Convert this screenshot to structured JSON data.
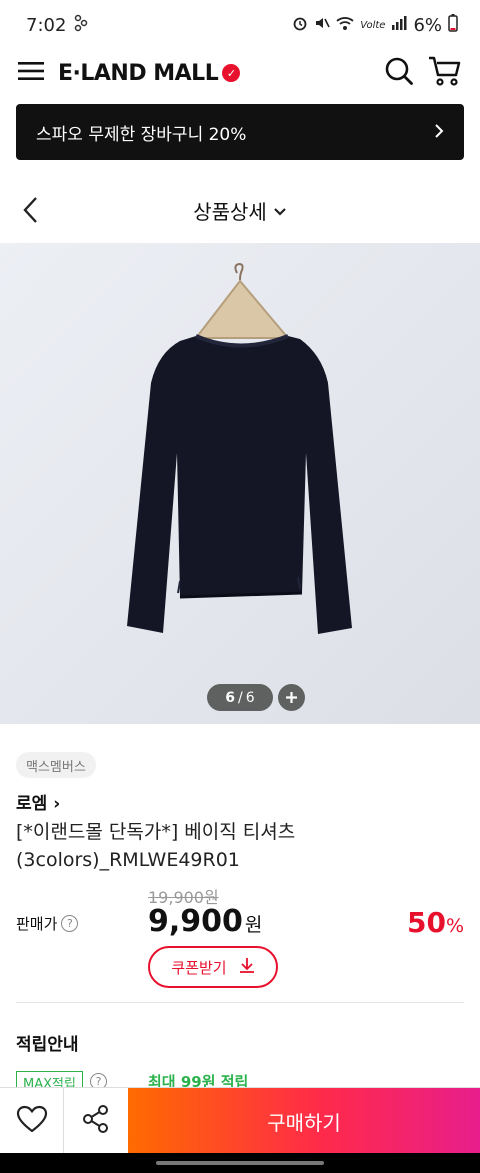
{
  "status_bar": {
    "time": "7:02",
    "battery": "6%",
    "network": "Volte"
  },
  "header": {
    "logo_text": "E·LAND MALL"
  },
  "promo_banner": {
    "text": "스파오 무제한 장바구니 20%"
  },
  "page_nav": {
    "title": "상품상세"
  },
  "gallery": {
    "current": "6",
    "separator": "/",
    "total": "6"
  },
  "product": {
    "member_tag": "맥스멤버스",
    "brand": "로엠 ›",
    "name_line1": "[*이랜드몰 단독가*] 베이직 티셔츠",
    "name_line2": "(3colors)_RMLWE49R01",
    "original_price": "19,900원",
    "sale_label": "판매가",
    "sale_price": "9,900",
    "currency": "원",
    "discount": "50",
    "discount_unit": "%",
    "coupon_label": "쿠폰받기"
  },
  "points": {
    "title": "적립안내",
    "max_tag": "MAX적립",
    "max_value": "최대 99원 적립"
  },
  "bottom_bar": {
    "buy_label": "구매하기"
  },
  "colors": {
    "accent": "#e8112d",
    "points_green": "#2bb24c",
    "buy_gradient_start": "#ff6a00",
    "buy_gradient_end": "#e81e8c"
  }
}
